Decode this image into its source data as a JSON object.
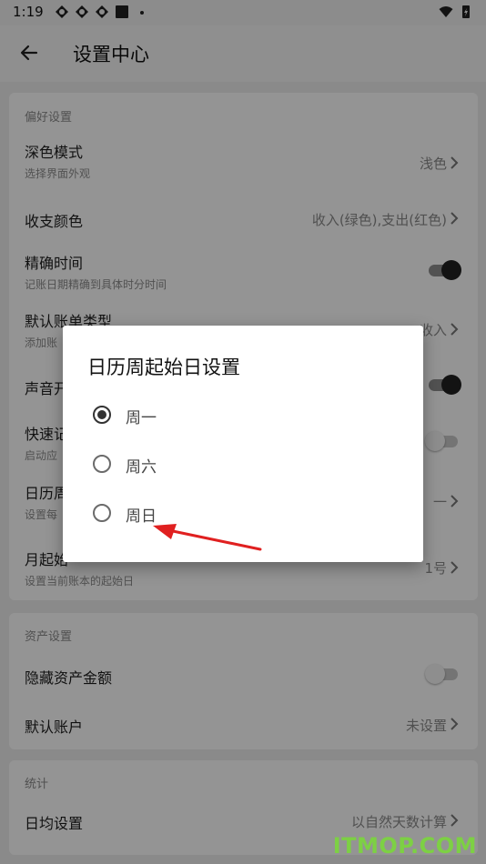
{
  "status_bar": {
    "time": "1:19",
    "icons": [
      "app-icon",
      "app-icon",
      "app-icon",
      "square-icon",
      "dot-icon"
    ],
    "right_icons": [
      "wifi-icon",
      "battery-icon"
    ]
  },
  "app_bar": {
    "title": "设置中心",
    "back_icon": "arrow-left-icon"
  },
  "sections": {
    "preferences": {
      "title": "偏好设置",
      "dark_mode": {
        "label": "深色模式",
        "desc": "选择界面外观",
        "value": "浅色"
      },
      "income_color": {
        "label": "收支颜色",
        "value": "收入(绿色),支出(红色)"
      },
      "precise_time": {
        "label": "精确时间",
        "desc": "记账日期精确到具体时分时间",
        "enabled": true
      },
      "default_bill_type": {
        "label": "默认账单类型",
        "desc": "添加账",
        "value": "收入"
      },
      "sound": {
        "label": "声音开",
        "enabled": true
      },
      "quick_note": {
        "label": "快速记",
        "desc": "启动应",
        "enabled": false
      },
      "calendar_week": {
        "label": "日历周",
        "desc": "设置每",
        "value": "一"
      },
      "month_start": {
        "label": "月起始",
        "desc": "设置当前账本的起始日",
        "value": "1号"
      }
    },
    "assets": {
      "title": "资产设置",
      "hide_amount": {
        "label": "隐藏资产金额",
        "enabled": false
      },
      "default_account": {
        "label": "默认账户",
        "value": "未设置"
      }
    },
    "stats": {
      "title": "统计",
      "daily_avg": {
        "label": "日均设置",
        "value": "以自然天数计算"
      }
    }
  },
  "dialog": {
    "title": "日历周起始日设置",
    "options": [
      {
        "label": "周一",
        "selected": true
      },
      {
        "label": "周六",
        "selected": false
      },
      {
        "label": "周日",
        "selected": false
      }
    ]
  },
  "watermark": "ITMOP.COM",
  "colors": {
    "scrim": "#000000",
    "annotation_arrow": "#e02020",
    "watermark": "#7bd73c"
  }
}
